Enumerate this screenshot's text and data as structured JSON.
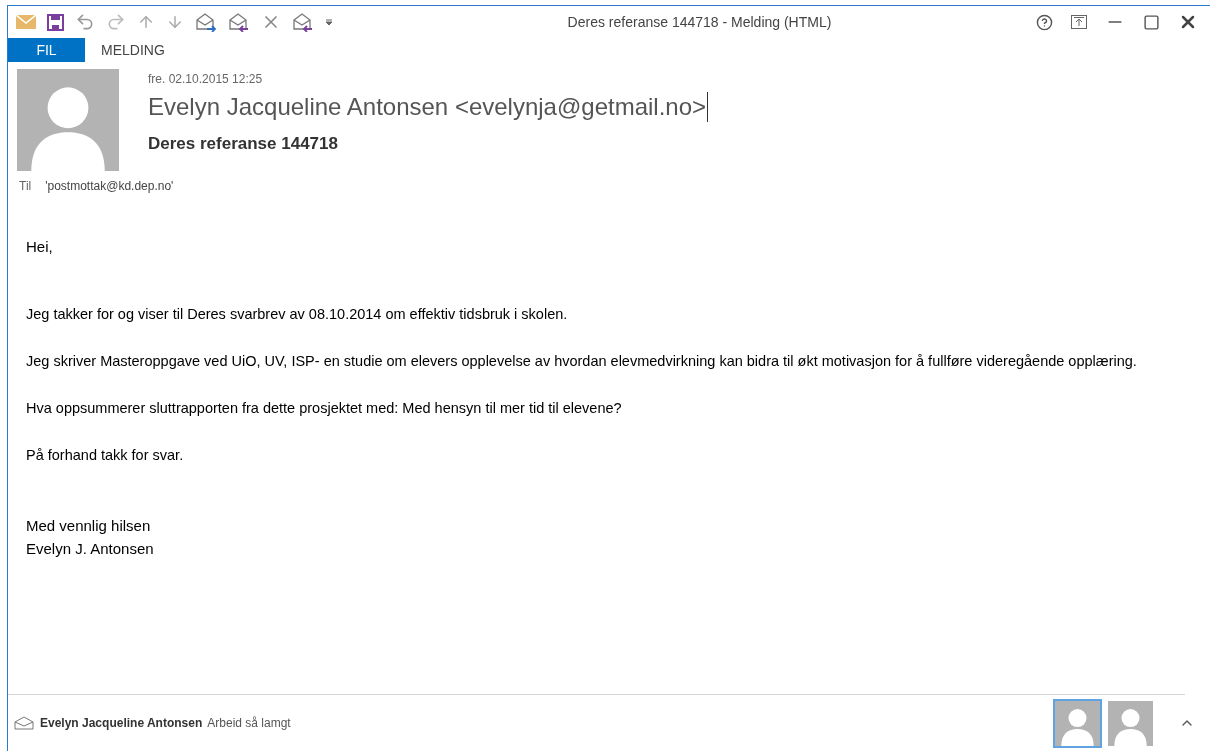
{
  "window": {
    "title": "Deres referanse 144718 - Melding (HTML)"
  },
  "tabs": [
    {
      "label": "FIL",
      "selected": true
    },
    {
      "label": "MELDING",
      "selected": false
    }
  ],
  "message": {
    "date": "fre. 02.10.2015 12:25",
    "sender": "Evelyn Jacqueline Antonsen <evelynja@getmail.no>",
    "subject": "Deres referanse 144718",
    "to_label": "Til",
    "to": "'postmottak@kd.dep.no'"
  },
  "body": {
    "greeting": "Hei,",
    "paragraphs": [
      "Jeg takker for og viser til Deres svarbrev av 08.10.2014 om effektiv tidsbruk i skolen.",
      "Jeg skriver Masteroppgave ved UiO, UV, ISP- en studie om elevers opplevelse av hvordan elevmedvirkning kan bidra til økt motivasjon for å fullføre videregående opplæring.",
      "Hva oppsummerer sluttrapporten fra dette prosjektet med: Med hensyn til mer tid til elevene?",
      "På forhand takk for svar."
    ],
    "closing": [
      "Med vennlig hilsen",
      "Evelyn J. Antonsen"
    ]
  },
  "people_pane": {
    "name": "Evelyn Jacqueline Antonsen",
    "status": "Arbeid så lamgt",
    "avatars": [
      {
        "selected": true
      },
      {
        "selected": false
      }
    ]
  }
}
